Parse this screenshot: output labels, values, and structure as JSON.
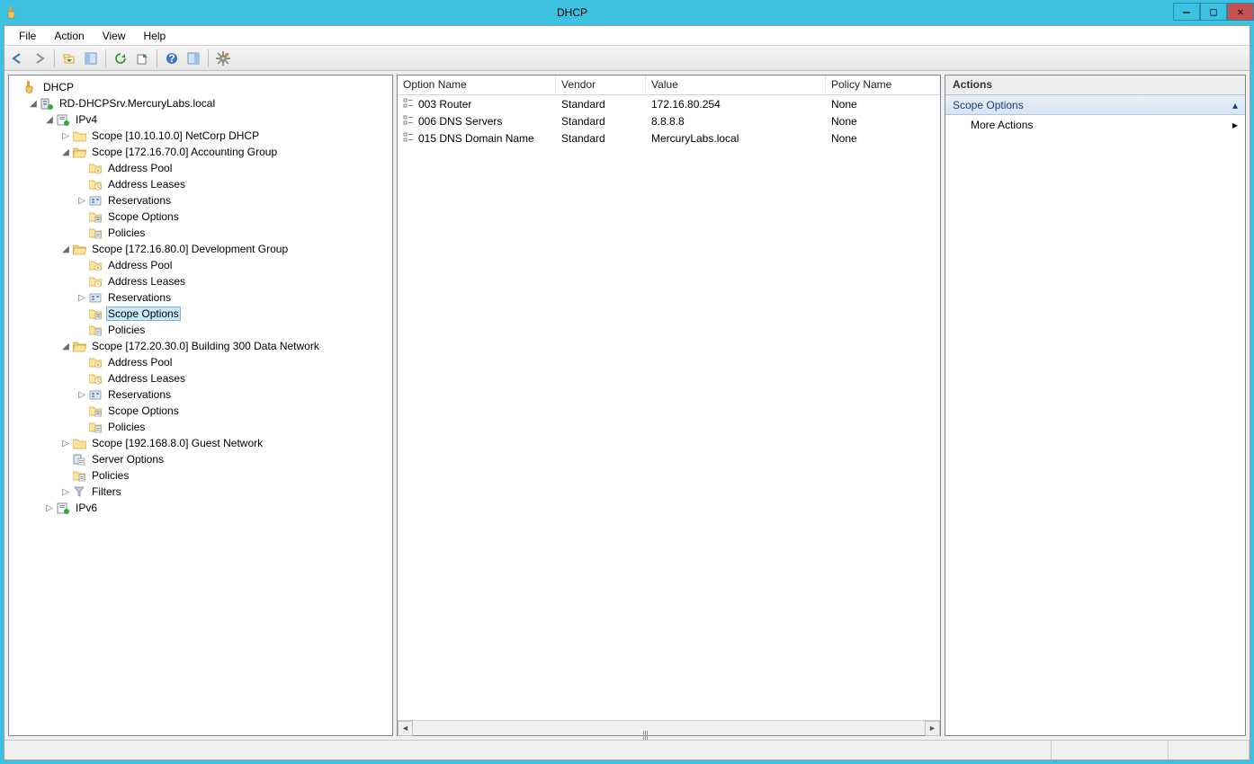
{
  "window": {
    "title": "DHCP"
  },
  "menu": {
    "file": "File",
    "action": "Action",
    "view": "View",
    "help": "Help"
  },
  "toolbar_icons": [
    "back",
    "forward",
    "up",
    "show-hide-tree",
    "refresh",
    "export",
    "help",
    "show-hide-action",
    "configure-options"
  ],
  "tree": {
    "root": "DHCP",
    "server": "RD-DHCPSrv.MercuryLabs.local",
    "ipv4": "IPv4",
    "ipv6": "IPv6",
    "scopes": [
      {
        "name": "Scope [10.10.10.0] NetCorp DHCP",
        "expanded": false
      },
      {
        "name": "Scope [172.16.70.0] Accounting Group",
        "expanded": true,
        "items": [
          "Address Pool",
          "Address Leases",
          "Reservations",
          "Scope Options",
          "Policies"
        ]
      },
      {
        "name": "Scope [172.16.80.0] Development Group",
        "expanded": true,
        "items": [
          "Address Pool",
          "Address Leases",
          "Reservations",
          "Scope Options",
          "Policies"
        ],
        "selected_item": "Scope Options"
      },
      {
        "name": "Scope [172.20.30.0] Building 300 Data Network",
        "expanded": true,
        "items": [
          "Address Pool",
          "Address Leases",
          "Reservations",
          "Scope Options",
          "Policies"
        ]
      },
      {
        "name": "Scope [192.168.8.0] Guest Network",
        "expanded": false
      }
    ],
    "ipv4_tail": [
      "Server Options",
      "Policies",
      "Filters"
    ]
  },
  "list": {
    "columns": {
      "option": "Option Name",
      "vendor": "Vendor",
      "value": "Value",
      "policy": "Policy Name"
    },
    "rows": [
      {
        "option": "003 Router",
        "vendor": "Standard",
        "value": "172.16.80.254",
        "policy": "None"
      },
      {
        "option": "006 DNS Servers",
        "vendor": "Standard",
        "value": "8.8.8.8",
        "policy": "None"
      },
      {
        "option": "015 DNS Domain Name",
        "vendor": "Standard",
        "value": "MercuryLabs.local",
        "policy": "None"
      }
    ]
  },
  "actions": {
    "header": "Actions",
    "section": "Scope Options",
    "more": "More Actions"
  }
}
